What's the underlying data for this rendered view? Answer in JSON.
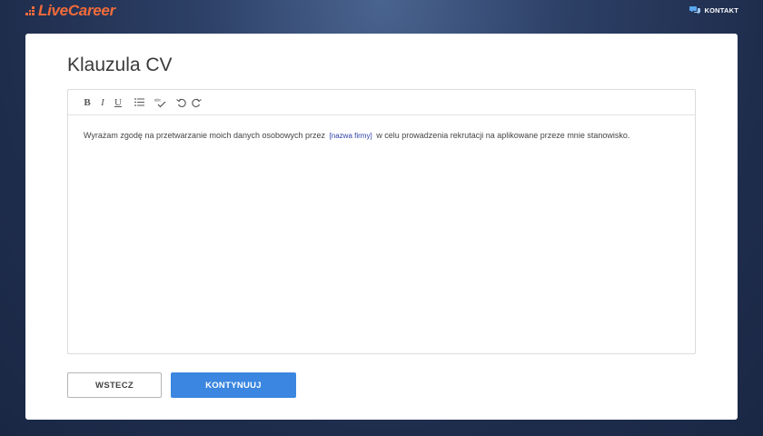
{
  "header": {
    "logo_text": "LiveCareer",
    "contact_label": "KONTAKT",
    "contact_icon": "chat-bubbles-icon",
    "brand_color": "#f26b3a"
  },
  "page": {
    "title": "Klauzula CV"
  },
  "editor": {
    "toolbar": {
      "bold": "B",
      "italic": "I",
      "underline": "U",
      "list_icon": "bullet-list-icon",
      "spellcheck_icon": "spellcheck-icon",
      "undo_icon": "undo-icon",
      "redo_icon": "redo-icon"
    },
    "content": {
      "text_before": "Wyrażam zgodę na przetwarzanie moich danych osobowych przez",
      "placeholder": "[nazwa firmy]",
      "text_after": "w celu prowadzenia rekrutacji na aplikowane przeze mnie stanowisko."
    }
  },
  "actions": {
    "back_label": "WSTECZ",
    "continue_label": "KONTYNUUJ",
    "primary_color": "#3a86e0"
  }
}
